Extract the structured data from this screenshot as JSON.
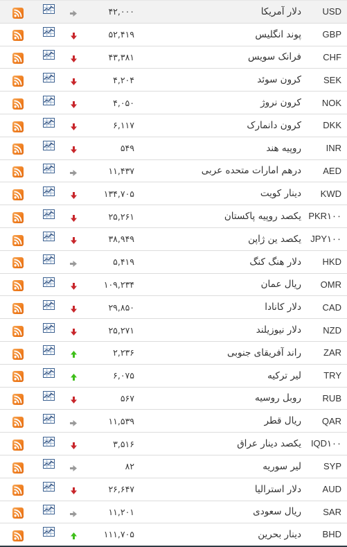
{
  "colors": {
    "down": "#c8262b",
    "up": "#3fbf1a",
    "flat": "#9a9a9a",
    "rss": "#ef7d1f",
    "chart_icon": "#3a5f8f"
  },
  "rows": [
    {
      "code": "USD",
      "name": "دلار آمریکا",
      "price": "۴۲,۰۰۰",
      "trend": "flat",
      "trend_icon": "arrow-right-icon"
    },
    {
      "code": "GBP",
      "name": "پوند انگلیس",
      "price": "۵۲,۴۱۹",
      "trend": "down",
      "trend_icon": "arrow-down-icon"
    },
    {
      "code": "CHF",
      "name": "فرانک سویس",
      "price": "۴۳,۳۸۱",
      "trend": "down",
      "trend_icon": "arrow-down-icon"
    },
    {
      "code": "SEK",
      "name": "کرون سوئد",
      "price": "۴,۲۰۴",
      "trend": "down",
      "trend_icon": "arrow-down-icon"
    },
    {
      "code": "NOK",
      "name": "کرون نروژ",
      "price": "۴,۰۵۰",
      "trend": "down",
      "trend_icon": "arrow-down-icon"
    },
    {
      "code": "DKK",
      "name": "کرون دانمارک",
      "price": "۶,۱۱۷",
      "trend": "down",
      "trend_icon": "arrow-down-icon"
    },
    {
      "code": "INR",
      "name": "روپیه هند",
      "price": "۵۴۹",
      "trend": "down",
      "trend_icon": "arrow-down-icon"
    },
    {
      "code": "AED",
      "name": "درهم امارات متحده عربی",
      "price": "۱۱,۴۳۷",
      "trend": "flat",
      "trend_icon": "arrow-right-icon"
    },
    {
      "code": "KWD",
      "name": "دینار کویت",
      "price": "۱۳۴,۷۰۵",
      "trend": "down",
      "trend_icon": "arrow-down-icon"
    },
    {
      "code": "PKR۱۰۰",
      "name": "یکصد روپیه پاکستان",
      "price": "۲۵,۲۶۱",
      "trend": "down",
      "trend_icon": "arrow-down-icon"
    },
    {
      "code": "JPY۱۰۰",
      "name": "یکصد ین ژاپن",
      "price": "۳۸,۹۴۹",
      "trend": "down",
      "trend_icon": "arrow-down-icon"
    },
    {
      "code": "HKD",
      "name": "دلار هنگ کنگ",
      "price": "۵,۴۱۹",
      "trend": "flat",
      "trend_icon": "arrow-right-icon"
    },
    {
      "code": "OMR",
      "name": "ریال عمان",
      "price": "۱۰۹,۲۳۴",
      "trend": "down",
      "trend_icon": "arrow-down-icon"
    },
    {
      "code": "CAD",
      "name": "دلار کانادا",
      "price": "۲۹,۸۵۰",
      "trend": "down",
      "trend_icon": "arrow-down-icon"
    },
    {
      "code": "NZD",
      "name": "دلار نیوزیلند",
      "price": "۲۵,۲۷۱",
      "trend": "down",
      "trend_icon": "arrow-down-icon"
    },
    {
      "code": "ZAR",
      "name": "راند آفریقای جنوبی",
      "price": "۲,۲۳۶",
      "trend": "up",
      "trend_icon": "arrow-up-icon"
    },
    {
      "code": "TRY",
      "name": "لیر ترکیه",
      "price": "۶,۰۷۵",
      "trend": "up",
      "trend_icon": "arrow-up-icon"
    },
    {
      "code": "RUB",
      "name": "روبل روسیه",
      "price": "۵۶۷",
      "trend": "down",
      "trend_icon": "arrow-down-icon"
    },
    {
      "code": "QAR",
      "name": "ریال قطر",
      "price": "۱۱,۵۳۹",
      "trend": "flat",
      "trend_icon": "arrow-right-icon"
    },
    {
      "code": "IQD۱۰۰",
      "name": "یکصد دینار عراق",
      "price": "۳,۵۱۶",
      "trend": "down",
      "trend_icon": "arrow-down-icon"
    },
    {
      "code": "SYP",
      "name": "لیر سوریه",
      "price": "۸۲",
      "trend": "flat",
      "trend_icon": "arrow-right-icon"
    },
    {
      "code": "AUD",
      "name": "دلار استرالیا",
      "price": "۲۶,۶۴۷",
      "trend": "down",
      "trend_icon": "arrow-down-icon"
    },
    {
      "code": "SAR",
      "name": "ریال سعودی",
      "price": "۱۱,۲۰۱",
      "trend": "flat",
      "trend_icon": "arrow-right-icon"
    },
    {
      "code": "BHD",
      "name": "دینار بحرین",
      "price": "۱۱۱,۷۰۵",
      "trend": "up",
      "trend_icon": "arrow-up-icon"
    }
  ]
}
